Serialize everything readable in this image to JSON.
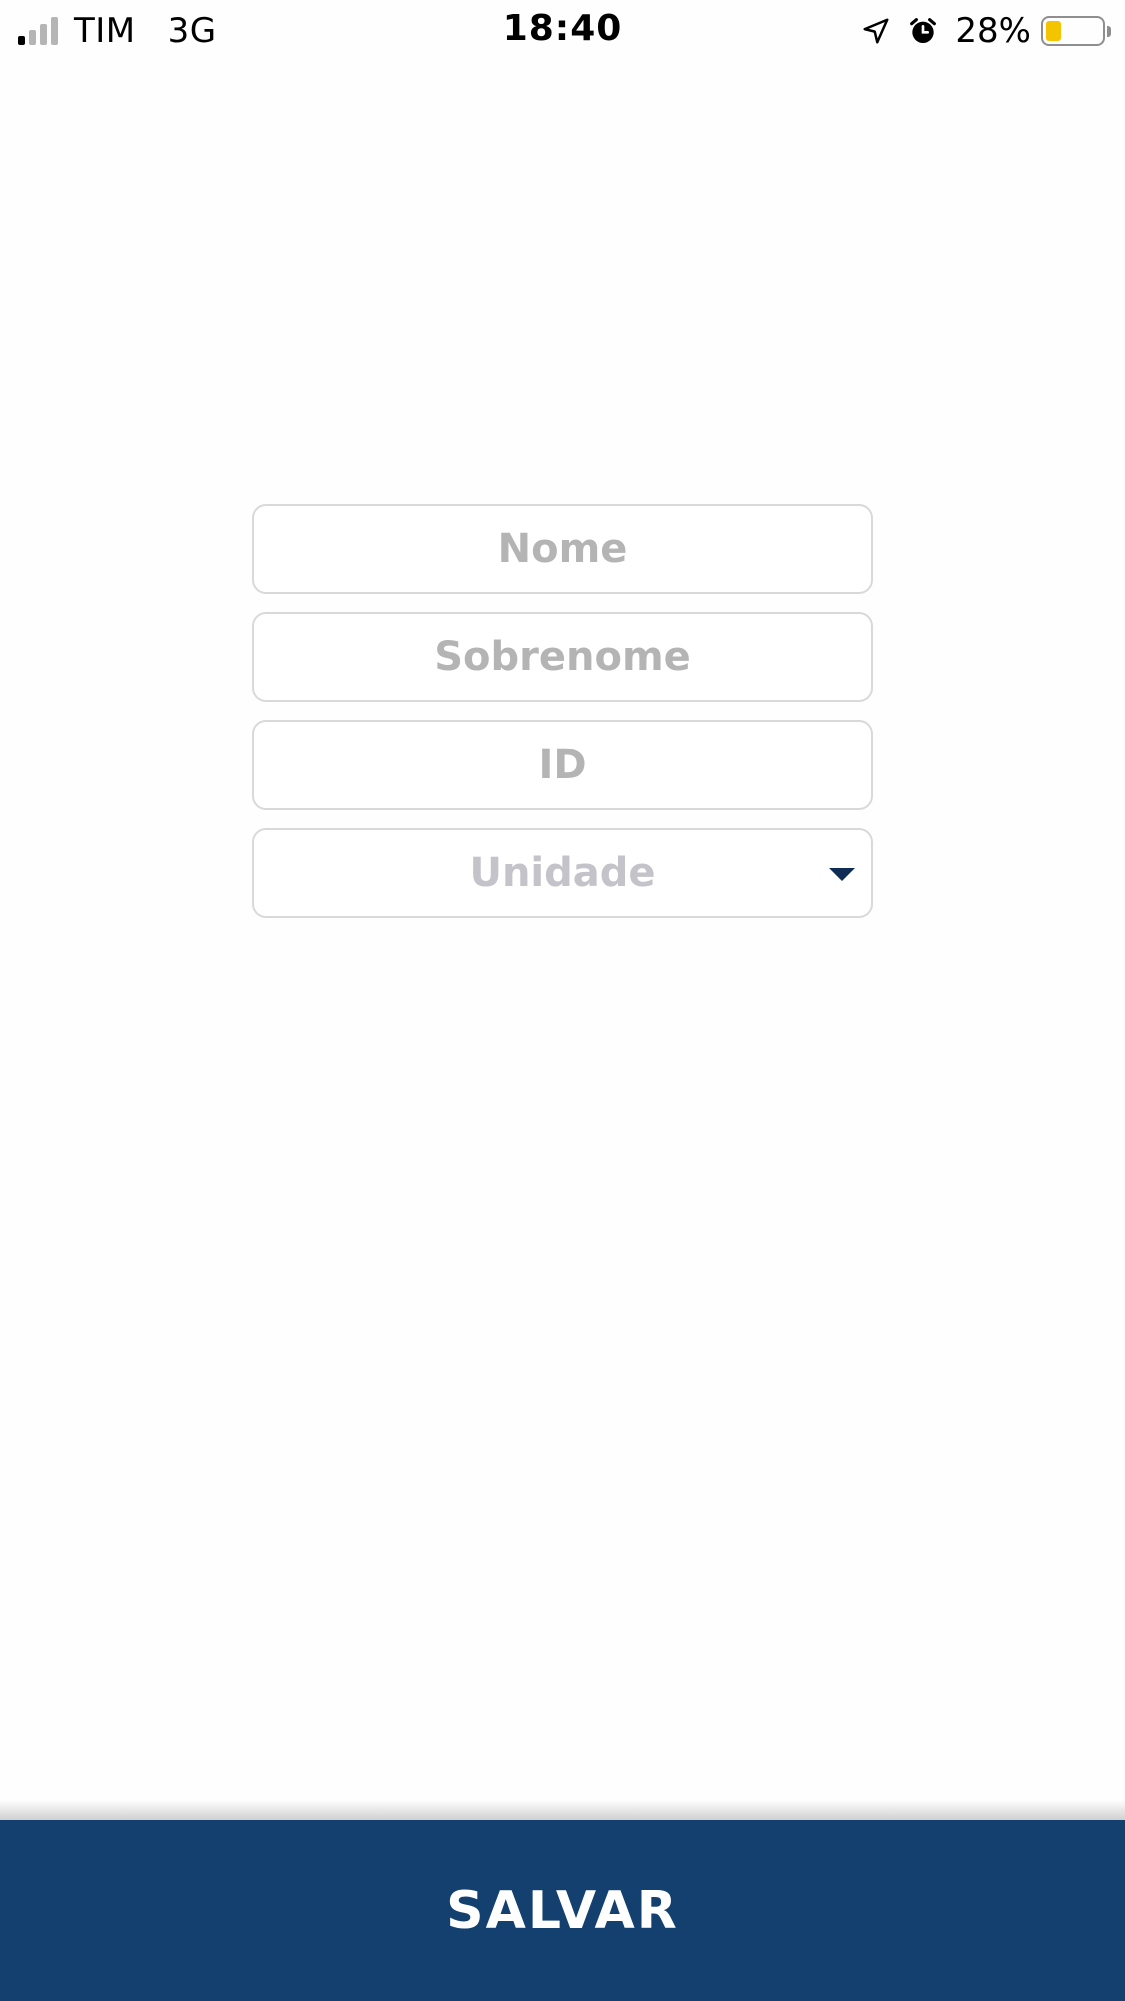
{
  "status_bar": {
    "carrier": "TIM",
    "network": "3G",
    "time": "18:40",
    "battery_percent": "28%",
    "battery_level": 0.28,
    "battery_color": "#f5c400",
    "signal_bars_active": 1,
    "signal_bars_total": 4,
    "icons": [
      "signal-icon",
      "location-arrow-icon",
      "alarm-clock-icon",
      "battery-icon"
    ]
  },
  "form": {
    "first_name": {
      "placeholder": "Nome",
      "value": ""
    },
    "last_name": {
      "placeholder": "Sobrenome",
      "value": ""
    },
    "id": {
      "placeholder": "ID",
      "value": ""
    },
    "unit": {
      "placeholder": "Unidade",
      "icon": "chevron-down-icon"
    }
  },
  "footer": {
    "save_label": "SALVAR",
    "button_color": "#13406f"
  }
}
